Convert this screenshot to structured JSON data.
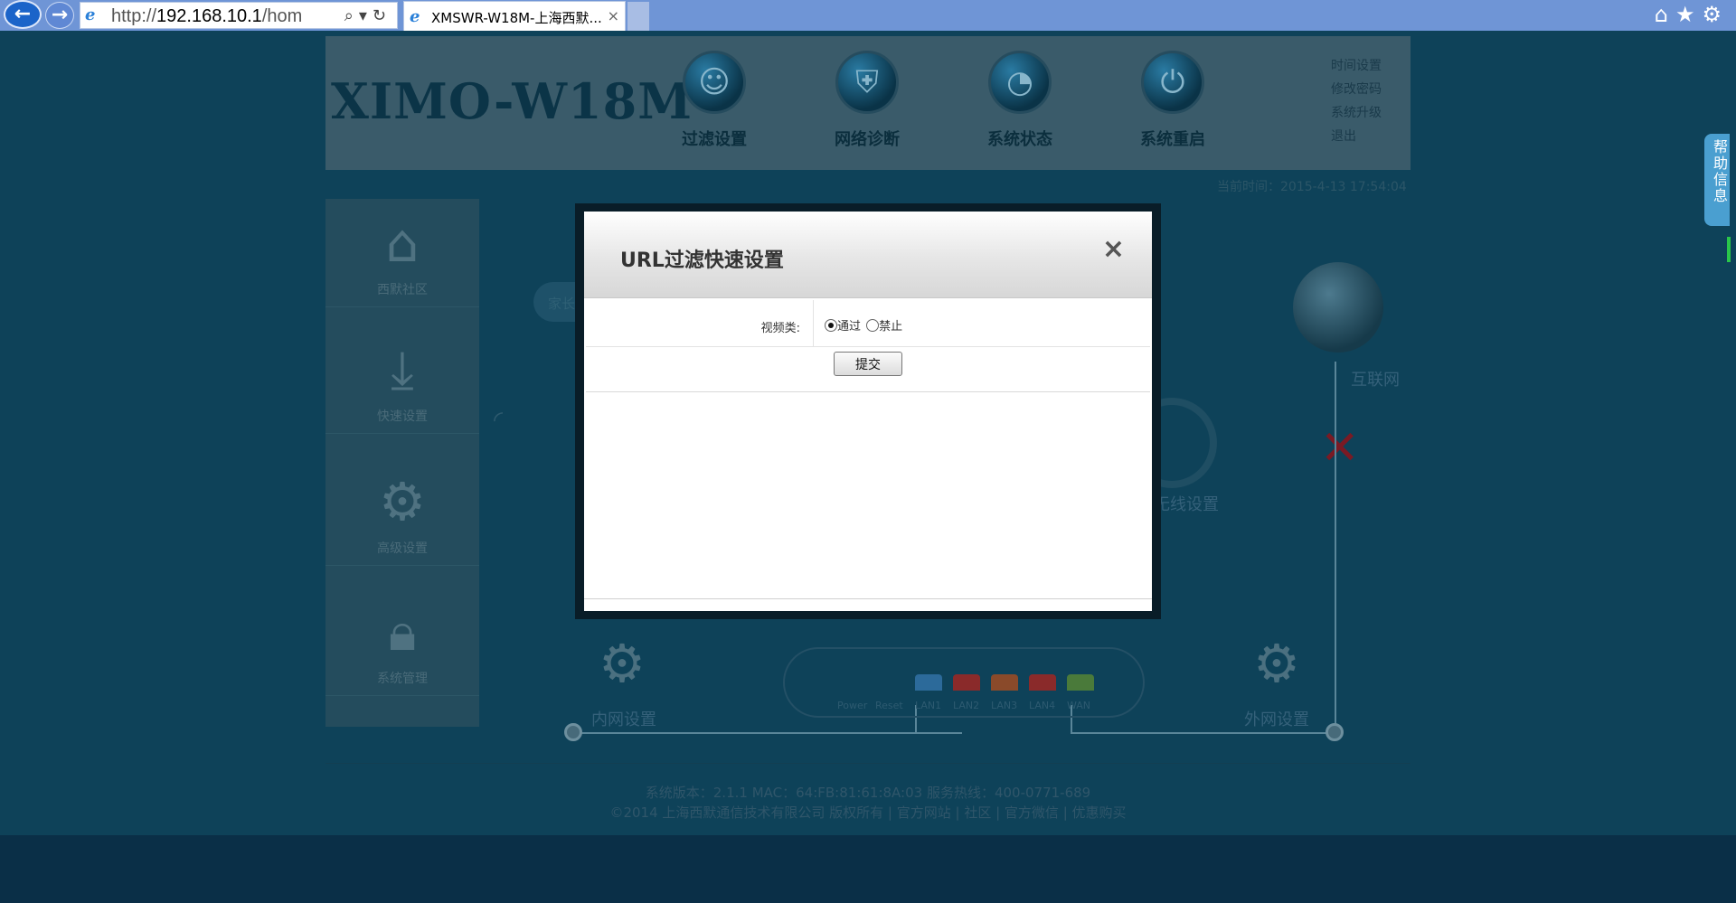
{
  "browser": {
    "url_prefix": "http://",
    "url_host": "192.168.10.1",
    "url_rest": "/hom",
    "tab_title": "XMSWR-W18M-上海西默...",
    "tab_close": "×"
  },
  "header": {
    "logo": "XIMO-W18M",
    "nav": [
      {
        "label": "过滤设置",
        "icon": "filter-user-icon"
      },
      {
        "label": "网络诊断",
        "icon": "shield-icon"
      },
      {
        "label": "系统状态",
        "icon": "clock-icon"
      },
      {
        "label": "系统重启",
        "icon": "power-icon"
      }
    ],
    "links": [
      "时间设置",
      "修改密码",
      "系统升级",
      "退出"
    ],
    "current_time": "当前时间：2015-4-13 17:54:04"
  },
  "sidebar": {
    "items": [
      {
        "label": "西默社区",
        "icon": "home-icon"
      },
      {
        "label": "快速设置",
        "icon": "download-gear-icon"
      },
      {
        "label": "高级设置",
        "icon": "gear-icon"
      },
      {
        "label": "系统管理",
        "icon": "lock-gear-icon"
      }
    ]
  },
  "diagram": {
    "pill": "家长",
    "internet": "互联网",
    "wireless": "无线设置",
    "lan_settings": "内网设置",
    "wan_settings": "外网设置",
    "ports": [
      "Power",
      "Reset",
      "LAN1",
      "LAN2",
      "LAN3",
      "LAN4",
      "WAN"
    ]
  },
  "modal": {
    "title": "URL过滤快速设置",
    "close": "×",
    "row_label": "视频类:",
    "option_pass": "通过",
    "option_block": "禁止",
    "selected": "通过",
    "submit": "提交"
  },
  "footer": {
    "line1": "系统版本：2.1.1 MAC：64:FB:81:61:8A:03 服务热线：400-0771-689",
    "line2": "©2014 上海西默通信技术有限公司 版权所有 | 官方网站 | 社区 | 官方微信 | 优惠购买"
  },
  "help_tab": "帮助信息",
  "colors": {
    "page_bg": "#0e4259",
    "header_bg": "#3a5b6a",
    "browser_bar": "#6f95d6",
    "port_lan1": "#2c6a9a",
    "port_lan_red": "#8a2a2a",
    "port_lan3": "#8a4a2a",
    "port_wan": "#4a7a3a"
  }
}
